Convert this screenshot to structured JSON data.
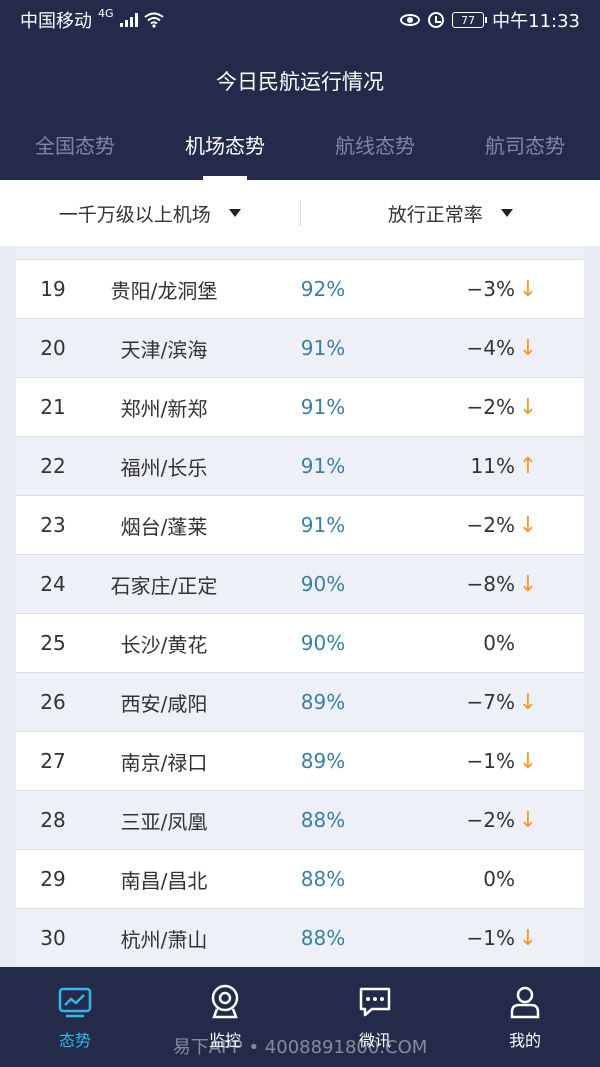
{
  "status_bar": {
    "carrier": "中国移动",
    "network": "4G",
    "battery": "77",
    "time": "中午11:33"
  },
  "header": {
    "title": "今日民航运行情况",
    "tabs": [
      {
        "label": "全国态势",
        "active": false
      },
      {
        "label": "机场态势",
        "active": true
      },
      {
        "label": "航线态势",
        "active": false
      },
      {
        "label": "航司态势",
        "active": false
      }
    ]
  },
  "filters": {
    "category": "一千万级以上机场",
    "metric": "放行正常率"
  },
  "rows": [
    {
      "rank": "19",
      "airport": "贵阳/龙洞堡",
      "rate": "92%",
      "change": "−3%",
      "trend": "↓"
    },
    {
      "rank": "20",
      "airport": "天津/滨海",
      "rate": "91%",
      "change": "−4%",
      "trend": "↓"
    },
    {
      "rank": "21",
      "airport": "郑州/新郑",
      "rate": "91%",
      "change": "−2%",
      "trend": "↓"
    },
    {
      "rank": "22",
      "airport": "福州/长乐",
      "rate": "91%",
      "change": "11%",
      "trend": "↑"
    },
    {
      "rank": "23",
      "airport": "烟台/蓬莱",
      "rate": "91%",
      "change": "−2%",
      "trend": "↓"
    },
    {
      "rank": "24",
      "airport": "石家庄/正定",
      "rate": "90%",
      "change": "−8%",
      "trend": "↓"
    },
    {
      "rank": "25",
      "airport": "长沙/黄花",
      "rate": "90%",
      "change": "0%",
      "trend": ""
    },
    {
      "rank": "26",
      "airport": "西安/咸阳",
      "rate": "89%",
      "change": "−7%",
      "trend": "↓"
    },
    {
      "rank": "27",
      "airport": "南京/禄口",
      "rate": "89%",
      "change": "−1%",
      "trend": "↓"
    },
    {
      "rank": "28",
      "airport": "三亚/凤凰",
      "rate": "88%",
      "change": "−2%",
      "trend": "↓"
    },
    {
      "rank": "29",
      "airport": "南昌/昌北",
      "rate": "88%",
      "change": "0%",
      "trend": ""
    },
    {
      "rank": "30",
      "airport": "杭州/萧山",
      "rate": "88%",
      "change": "−1%",
      "trend": "↓"
    }
  ],
  "bottom_nav": [
    {
      "label": "态势",
      "icon": "trend-chart-icon",
      "active": true
    },
    {
      "label": "监控",
      "icon": "camera-icon",
      "active": false
    },
    {
      "label": "微讯",
      "icon": "chat-bubble-icon",
      "active": false
    },
    {
      "label": "我的",
      "icon": "user-icon",
      "active": false
    }
  ],
  "watermark": "易下APP • 4008891800.COM",
  "colors": {
    "header_bg": "#242b4a",
    "rate_text": "#3a7fa4",
    "trend_arrow": "#f39a2d",
    "nav_active": "#35b6e8"
  }
}
